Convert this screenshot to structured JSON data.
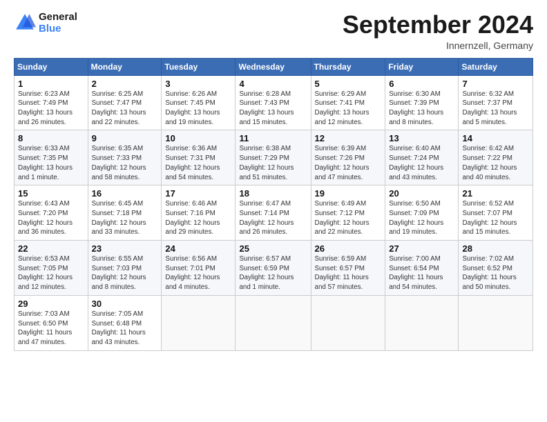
{
  "header": {
    "logo_line1": "General",
    "logo_line2": "Blue",
    "month_title": "September 2024",
    "subtitle": "Innernzell, Germany"
  },
  "weekdays": [
    "Sunday",
    "Monday",
    "Tuesday",
    "Wednesday",
    "Thursday",
    "Friday",
    "Saturday"
  ],
  "weeks": [
    [
      {
        "day": "1",
        "info": "Sunrise: 6:23 AM\nSunset: 7:49 PM\nDaylight: 13 hours\nand 26 minutes."
      },
      {
        "day": "2",
        "info": "Sunrise: 6:25 AM\nSunset: 7:47 PM\nDaylight: 13 hours\nand 22 minutes."
      },
      {
        "day": "3",
        "info": "Sunrise: 6:26 AM\nSunset: 7:45 PM\nDaylight: 13 hours\nand 19 minutes."
      },
      {
        "day": "4",
        "info": "Sunrise: 6:28 AM\nSunset: 7:43 PM\nDaylight: 13 hours\nand 15 minutes."
      },
      {
        "day": "5",
        "info": "Sunrise: 6:29 AM\nSunset: 7:41 PM\nDaylight: 13 hours\nand 12 minutes."
      },
      {
        "day": "6",
        "info": "Sunrise: 6:30 AM\nSunset: 7:39 PM\nDaylight: 13 hours\nand 8 minutes."
      },
      {
        "day": "7",
        "info": "Sunrise: 6:32 AM\nSunset: 7:37 PM\nDaylight: 13 hours\nand 5 minutes."
      }
    ],
    [
      {
        "day": "8",
        "info": "Sunrise: 6:33 AM\nSunset: 7:35 PM\nDaylight: 13 hours\nand 1 minute."
      },
      {
        "day": "9",
        "info": "Sunrise: 6:35 AM\nSunset: 7:33 PM\nDaylight: 12 hours\nand 58 minutes."
      },
      {
        "day": "10",
        "info": "Sunrise: 6:36 AM\nSunset: 7:31 PM\nDaylight: 12 hours\nand 54 minutes."
      },
      {
        "day": "11",
        "info": "Sunrise: 6:38 AM\nSunset: 7:29 PM\nDaylight: 12 hours\nand 51 minutes."
      },
      {
        "day": "12",
        "info": "Sunrise: 6:39 AM\nSunset: 7:26 PM\nDaylight: 12 hours\nand 47 minutes."
      },
      {
        "day": "13",
        "info": "Sunrise: 6:40 AM\nSunset: 7:24 PM\nDaylight: 12 hours\nand 43 minutes."
      },
      {
        "day": "14",
        "info": "Sunrise: 6:42 AM\nSunset: 7:22 PM\nDaylight: 12 hours\nand 40 minutes."
      }
    ],
    [
      {
        "day": "15",
        "info": "Sunrise: 6:43 AM\nSunset: 7:20 PM\nDaylight: 12 hours\nand 36 minutes."
      },
      {
        "day": "16",
        "info": "Sunrise: 6:45 AM\nSunset: 7:18 PM\nDaylight: 12 hours\nand 33 minutes."
      },
      {
        "day": "17",
        "info": "Sunrise: 6:46 AM\nSunset: 7:16 PM\nDaylight: 12 hours\nand 29 minutes."
      },
      {
        "day": "18",
        "info": "Sunrise: 6:47 AM\nSunset: 7:14 PM\nDaylight: 12 hours\nand 26 minutes."
      },
      {
        "day": "19",
        "info": "Sunrise: 6:49 AM\nSunset: 7:12 PM\nDaylight: 12 hours\nand 22 minutes."
      },
      {
        "day": "20",
        "info": "Sunrise: 6:50 AM\nSunset: 7:09 PM\nDaylight: 12 hours\nand 19 minutes."
      },
      {
        "day": "21",
        "info": "Sunrise: 6:52 AM\nSunset: 7:07 PM\nDaylight: 12 hours\nand 15 minutes."
      }
    ],
    [
      {
        "day": "22",
        "info": "Sunrise: 6:53 AM\nSunset: 7:05 PM\nDaylight: 12 hours\nand 12 minutes."
      },
      {
        "day": "23",
        "info": "Sunrise: 6:55 AM\nSunset: 7:03 PM\nDaylight: 12 hours\nand 8 minutes."
      },
      {
        "day": "24",
        "info": "Sunrise: 6:56 AM\nSunset: 7:01 PM\nDaylight: 12 hours\nand 4 minutes."
      },
      {
        "day": "25",
        "info": "Sunrise: 6:57 AM\nSunset: 6:59 PM\nDaylight: 12 hours\nand 1 minute."
      },
      {
        "day": "26",
        "info": "Sunrise: 6:59 AM\nSunset: 6:57 PM\nDaylight: 11 hours\nand 57 minutes."
      },
      {
        "day": "27",
        "info": "Sunrise: 7:00 AM\nSunset: 6:54 PM\nDaylight: 11 hours\nand 54 minutes."
      },
      {
        "day": "28",
        "info": "Sunrise: 7:02 AM\nSunset: 6:52 PM\nDaylight: 11 hours\nand 50 minutes."
      }
    ],
    [
      {
        "day": "29",
        "info": "Sunrise: 7:03 AM\nSunset: 6:50 PM\nDaylight: 11 hours\nand 47 minutes."
      },
      {
        "day": "30",
        "info": "Sunrise: 7:05 AM\nSunset: 6:48 PM\nDaylight: 11 hours\nand 43 minutes."
      },
      {
        "day": "",
        "info": ""
      },
      {
        "day": "",
        "info": ""
      },
      {
        "day": "",
        "info": ""
      },
      {
        "day": "",
        "info": ""
      },
      {
        "day": "",
        "info": ""
      }
    ]
  ]
}
